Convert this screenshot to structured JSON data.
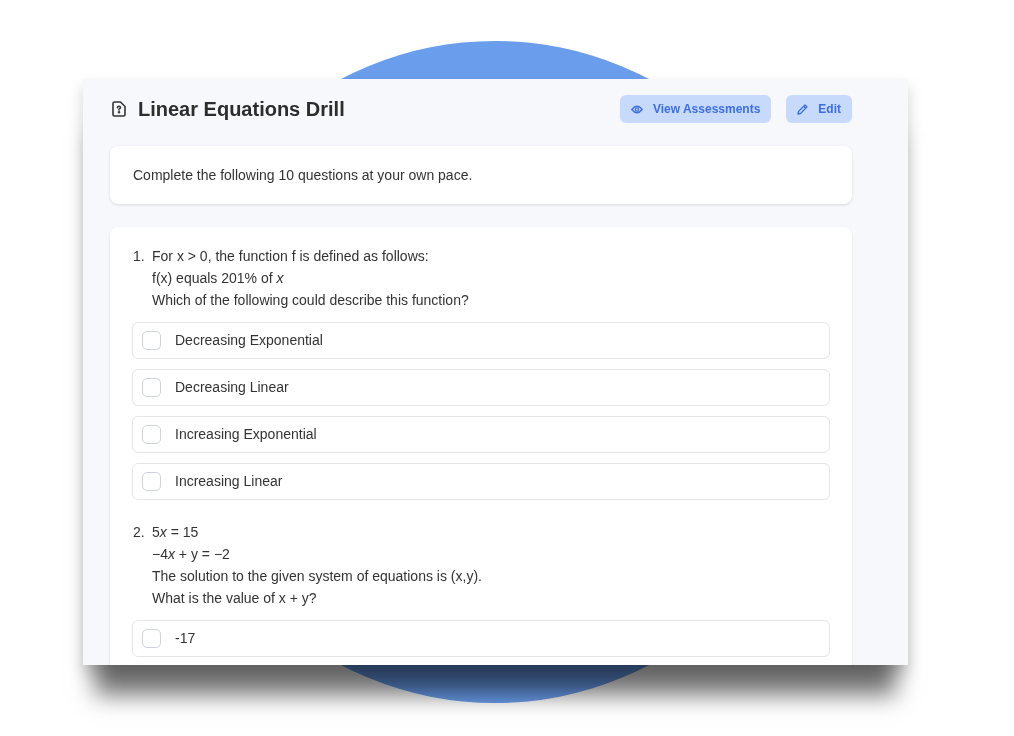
{
  "header": {
    "title": "Linear Equations Drill",
    "buttons": [
      {
        "label": "View Assessments",
        "kind": "view"
      },
      {
        "label": "Edit",
        "kind": "edit"
      }
    ]
  },
  "intro": "Complete the following 10 questions at your own pace.",
  "questions": [
    {
      "number": "1.",
      "lines": [
        "For x > 0, the function f is defined as follows:",
        "f(x) equals 201% of *x*",
        "Which of the following could describe this function?"
      ],
      "options": [
        {
          "label": "Decreasing Exponential",
          "checked": false
        },
        {
          "label": "Decreasing Linear",
          "checked": false
        },
        {
          "label": "Increasing Exponential",
          "checked": false
        },
        {
          "label": "Increasing Linear",
          "checked": false
        }
      ]
    },
    {
      "number": "2.",
      "lines": [
        [
          {
            "text": "5",
            "italic": false
          },
          {
            "text": "x",
            "italic": true
          },
          {
            "text": " = 15",
            "italic": false
          }
        ],
        [
          {
            "text": "−4",
            "italic": false
          },
          {
            "text": "x",
            "italic": true
          },
          {
            "text": " + y = −2",
            "italic": false
          }
        ],
        "The solution to the given system of equations is (x,y).",
        "What is the value of x + y?"
      ],
      "options": [
        {
          "label": "-17",
          "checked": false
        }
      ]
    }
  ]
}
